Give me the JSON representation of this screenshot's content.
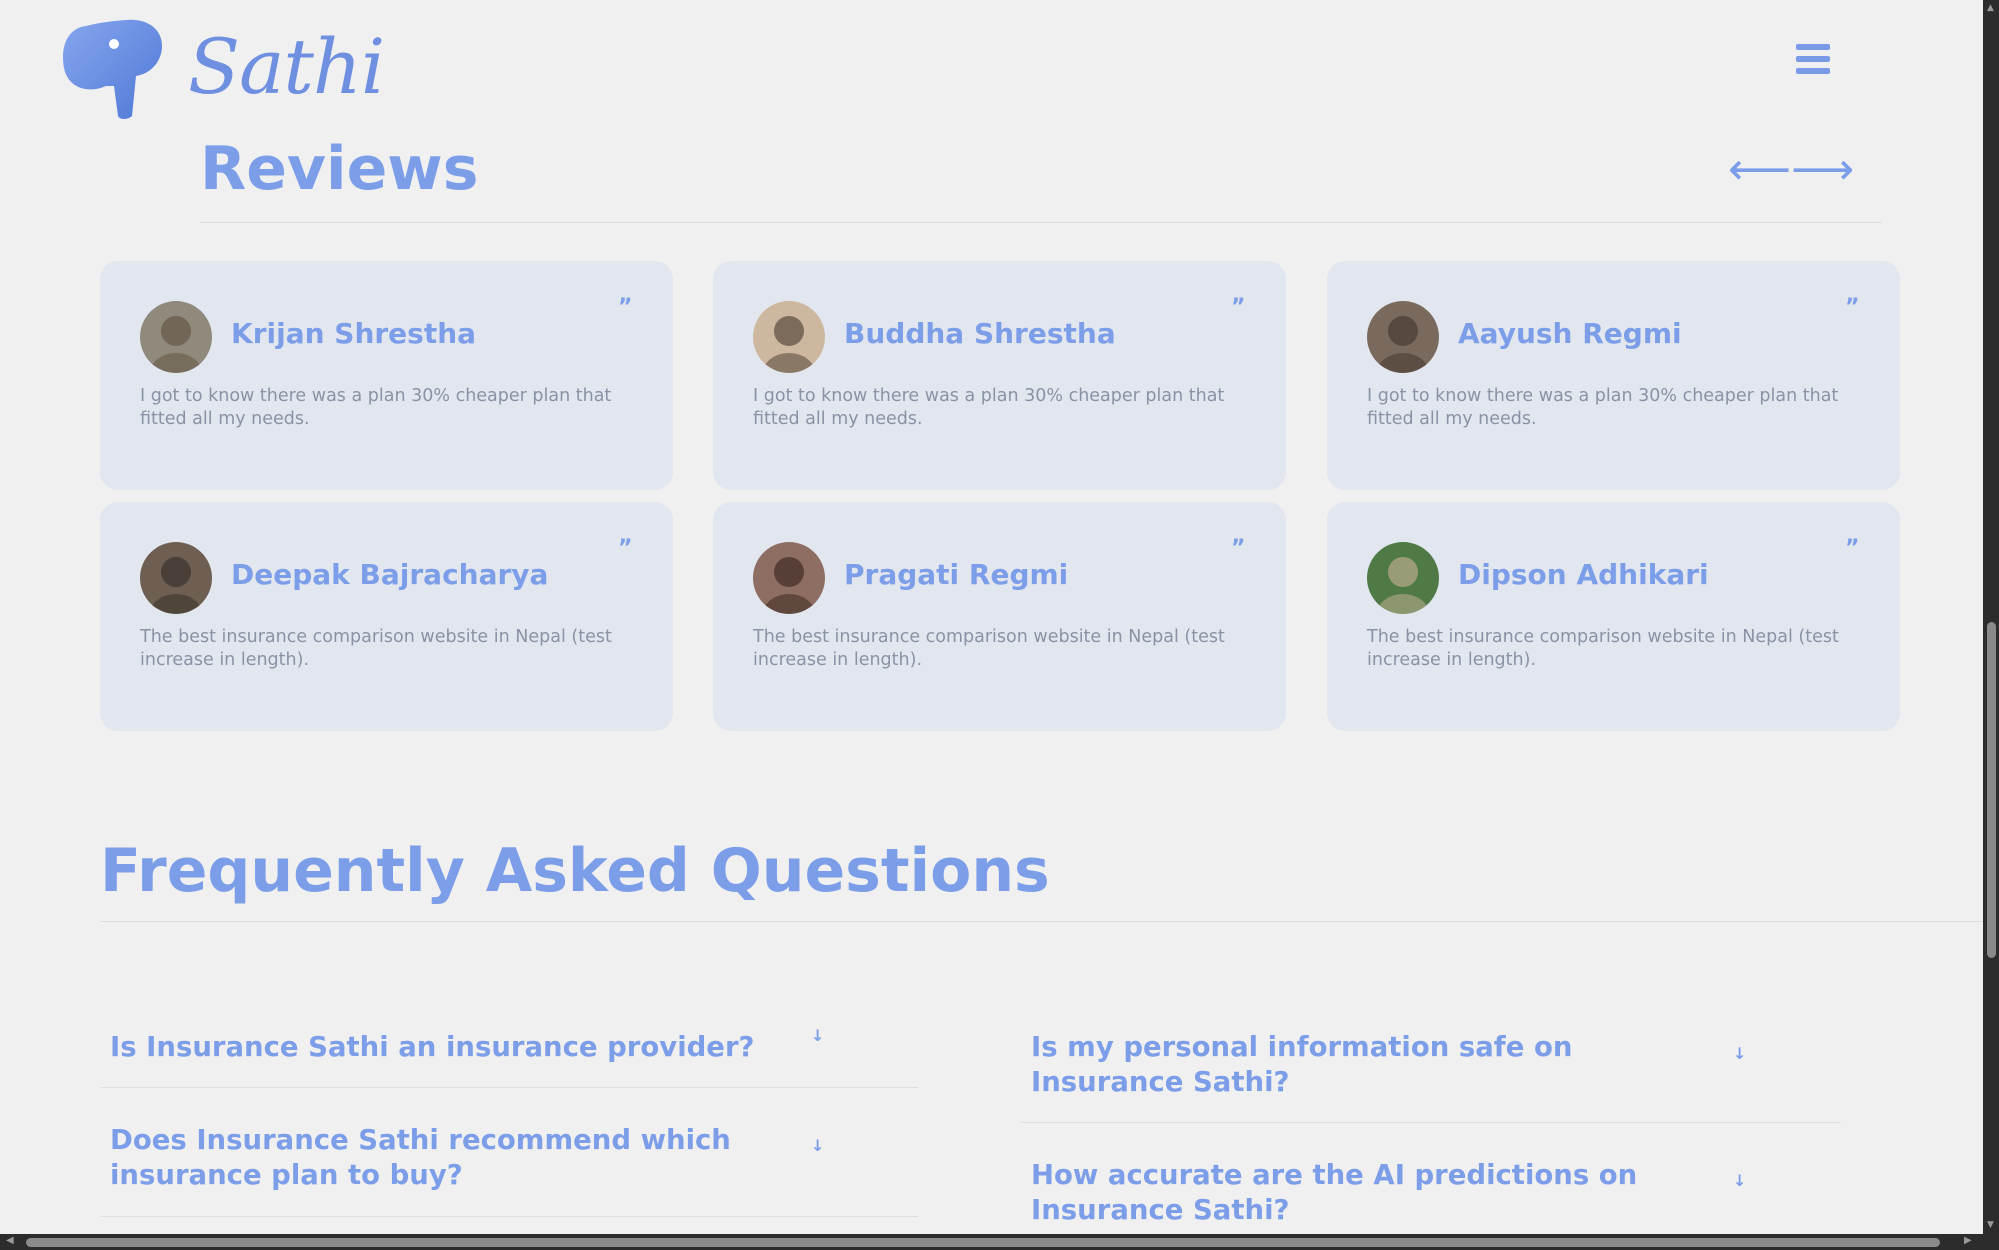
{
  "brand": {
    "logo_text": "Sathi"
  },
  "colors": {
    "accent": "#7c9ee9",
    "card_bg": "#e2e6ef",
    "page_bg": "#f0f0f0",
    "body_text": "#8a93a5"
  },
  "reviews": {
    "title": "Reviews",
    "prev_arrow": "⟵",
    "next_arrow": "⟶",
    "quote_mark": "”",
    "items": [
      {
        "name": "Krijan Shrestha",
        "text": "I got to know there was a plan 30% cheaper plan that fitted all my needs.",
        "avatar_bg": "#8f8a7c",
        "avatar_fg": "#5b4a38"
      },
      {
        "name": "Buddha Shrestha",
        "text": "I got to know there was a plan 30% cheaper plan that fitted all my needs.",
        "avatar_bg": "#cdb89f",
        "avatar_fg": "#3a2a22"
      },
      {
        "name": "Aayush Regmi",
        "text": "I got to know there was a plan 30% cheaper plan that fitted all my needs.",
        "avatar_bg": "#7a6a5e",
        "avatar_fg": "#3a2d26"
      },
      {
        "name": "Deepak Bajracharya",
        "text": "The best insurance comparison website in Nepal (test increase in length).",
        "avatar_bg": "#6e5f52",
        "avatar_fg": "#2d2520"
      },
      {
        "name": "Pragati Regmi",
        "text": "The best insurance comparison website in Nepal (test increase in length).",
        "avatar_bg": "#8e6e62",
        "avatar_fg": "#2a1a16"
      },
      {
        "name": "Dipson Adhikari",
        "text": "The best insurance comparison website in Nepal (test increase in length).",
        "avatar_bg": "#4f7a46",
        "avatar_fg": "#d8b8a2"
      }
    ]
  },
  "faq": {
    "title": "Frequently Asked Questions",
    "arrow": "↓",
    "left": [
      "Is Insurance Sathi an insurance provider?",
      "Does Insurance Sathi recommend which insurance plan to buy?"
    ],
    "right": [
      "Is my personal information safe on Insurance Sathi?",
      "How accurate are the AI predictions on Insurance Sathi?"
    ]
  }
}
